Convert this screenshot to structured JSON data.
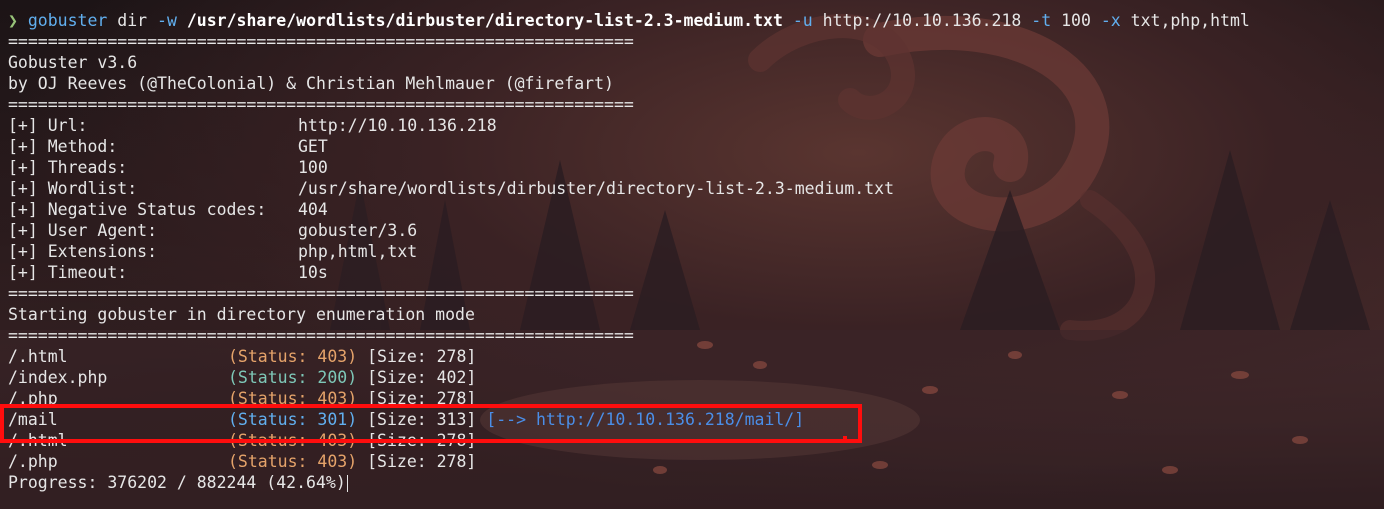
{
  "command": {
    "prompt_icon": "❯",
    "program": "gobuster",
    "subcommand": "dir",
    "wordlist_flag": "-w",
    "wordlist_path": "/usr/share/wordlists/dirbuster/directory-list-2.3-medium.txt",
    "url_flag": "-u",
    "url": "http://10.10.136.218",
    "threads_flag": "-t",
    "threads": "100",
    "ext_flag": "-x",
    "extensions": "txt,php,html"
  },
  "separator": "===============================================================",
  "banner": {
    "title": "Gobuster v3.6",
    "authors": "by OJ Reeves (@TheColonial) & Christian Mehlmauer (@firefart)"
  },
  "config": [
    {
      "label": "[+] Url:",
      "value": "http://10.10.136.218"
    },
    {
      "label": "[+] Method:",
      "value": "GET"
    },
    {
      "label": "[+] Threads:",
      "value": "100"
    },
    {
      "label": "[+] Wordlist:",
      "value": "/usr/share/wordlists/dirbuster/directory-list-2.3-medium.txt"
    },
    {
      "label": "[+] Negative Status codes:",
      "value": "404"
    },
    {
      "label": "[+] User Agent:",
      "value": "gobuster/3.6"
    },
    {
      "label": "[+] Extensions:",
      "value": "php,html,txt"
    },
    {
      "label": "[+] Timeout:",
      "value": "10s"
    }
  ],
  "start_message": "Starting gobuster in directory enumeration mode",
  "results": [
    {
      "path": "/.html",
      "status": "(Status: 403)",
      "size": "[Size: 278]",
      "redirect": ""
    },
    {
      "path": "/index.php",
      "status": "(Status: 200)",
      "size": "[Size: 402]",
      "redirect": ""
    },
    {
      "path": "/.php",
      "status": "(Status: 403)",
      "size": "[Size: 278]",
      "redirect": ""
    },
    {
      "path": "/mail",
      "status": "(Status: 301)",
      "size": "[Size: 313]",
      "redirect": "[--> http://10.10.136.218/mail/]"
    },
    {
      "path": "/.html",
      "status": "(Status: 403)",
      "size": "[Size: 278]",
      "redirect": ""
    },
    {
      "path": "/.php",
      "status": "(Status: 403)",
      "size": "[Size: 278]",
      "redirect": ""
    }
  ],
  "progress": "Progress: 376202 / 882244 (42.64%)",
  "colors": {
    "status_403": "#e5a36a",
    "status_200": "#7ec8b8",
    "status_301": "#61afef",
    "highlight": "#ff0d0d"
  }
}
